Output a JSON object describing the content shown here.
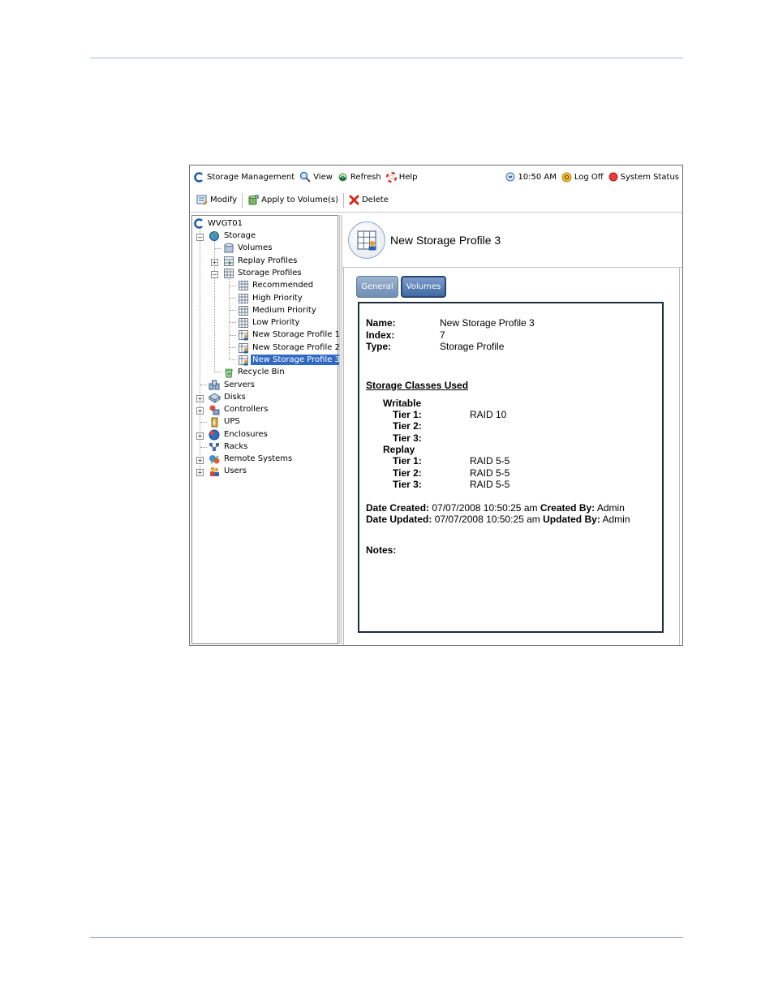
{
  "topbar": {
    "items": [
      "Storage Management",
      "View",
      "Refresh",
      "Help"
    ],
    "time": "10:50 AM",
    "logoff": "Log Off",
    "status": "System Status"
  },
  "toolbar": {
    "modify": "Modify",
    "apply": "Apply to Volume(s)",
    "delete": "Delete"
  },
  "tree": {
    "root": "WVGT01",
    "storage": "Storage",
    "volumes": "Volumes",
    "replay_profiles": "Replay Profiles",
    "storage_profiles": "Storage Profiles",
    "profiles": [
      "Recommended",
      "High Priority",
      "Medium Priority",
      "Low Priority",
      "New Storage Profile 1",
      "New Storage Profile 2",
      "New Storage Profile 3"
    ],
    "recycle_bin": "Recycle Bin",
    "servers": "Servers",
    "disks": "Disks",
    "controllers": "Controllers",
    "ups": "UPS",
    "enclosures": "Enclosures",
    "racks": "Racks",
    "remote_systems": "Remote Systems",
    "users": "Users"
  },
  "panel": {
    "title": "New Storage Profile 3",
    "tabs": [
      "General",
      "Volumes"
    ]
  },
  "details": {
    "name_label": "Name:",
    "name_value": "New Storage Profile 3",
    "index_label": "Index:",
    "index_value": "7",
    "type_label": "Type:",
    "type_value": "Storage Profile",
    "classes_heading": "Storage Classes Used",
    "writable": "Writable",
    "replay": "Replay",
    "tier1": "Tier 1:",
    "tier2": "Tier 2:",
    "tier3": "Tier 3:",
    "writable_tier1": "RAID 10",
    "replay_tier1": "RAID 5-5",
    "replay_tier2": "RAID 5-5",
    "replay_tier3": "RAID 5-5",
    "created_label": "Date Created:",
    "created_value": "07/07/2008 10:50:25 am",
    "created_by_label": "Created By:",
    "created_by_value": "Admin",
    "updated_label": "Date Updated:",
    "updated_value": "07/07/2008 10:50:25 am",
    "updated_by_label": "Updated By:",
    "updated_by_value": "Admin",
    "notes_label": "Notes:"
  }
}
